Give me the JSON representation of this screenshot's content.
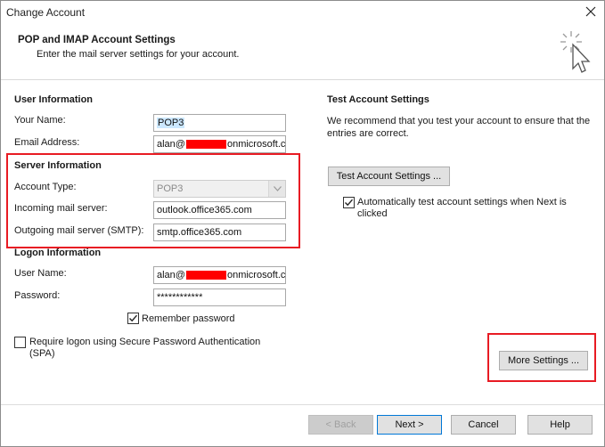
{
  "window": {
    "title": "Change Account"
  },
  "header": {
    "title": "POP and IMAP Account Settings",
    "subtitle": "Enter the mail server settings for your account."
  },
  "user_info": {
    "heading": "User Information",
    "name_label": "Your Name:",
    "name_value": "POP3",
    "email_label": "Email Address:",
    "email_prefix": "alan@",
    "email_suffix": "onmicrosoft.co"
  },
  "server_info": {
    "heading": "Server Information",
    "account_type_label": "Account Type:",
    "account_type_value": "POP3",
    "incoming_label": "Incoming mail server:",
    "incoming_value": "outlook.office365.com",
    "outgoing_label": "Outgoing mail server (SMTP):",
    "outgoing_value": "smtp.office365.com"
  },
  "logon_info": {
    "heading": "Logon Information",
    "username_label": "User Name:",
    "username_prefix": "alan@",
    "username_suffix": "onmicrosoft.co",
    "password_label": "Password:",
    "password_value": "************",
    "remember_label": "Remember password",
    "remember_checked": true,
    "spa_label": "Require logon using Secure Password Authentication (SPA)",
    "spa_checked": false
  },
  "test_settings": {
    "heading": "Test Account Settings",
    "description": "We recommend that you test your account to ensure that the entries are correct.",
    "test_button": "Test Account Settings ...",
    "auto_test_label": "Automatically test account settings when Next is clicked",
    "auto_test_checked": true
  },
  "more_settings_button": "More Settings ...",
  "footer": {
    "back": "< Back",
    "next": "Next >",
    "cancel": "Cancel",
    "help": "Help"
  },
  "colors": {
    "highlight_box": "#e81b23",
    "redaction": "#ff0000",
    "selection": "#cce8ff",
    "primary_border": "#0078d7"
  }
}
